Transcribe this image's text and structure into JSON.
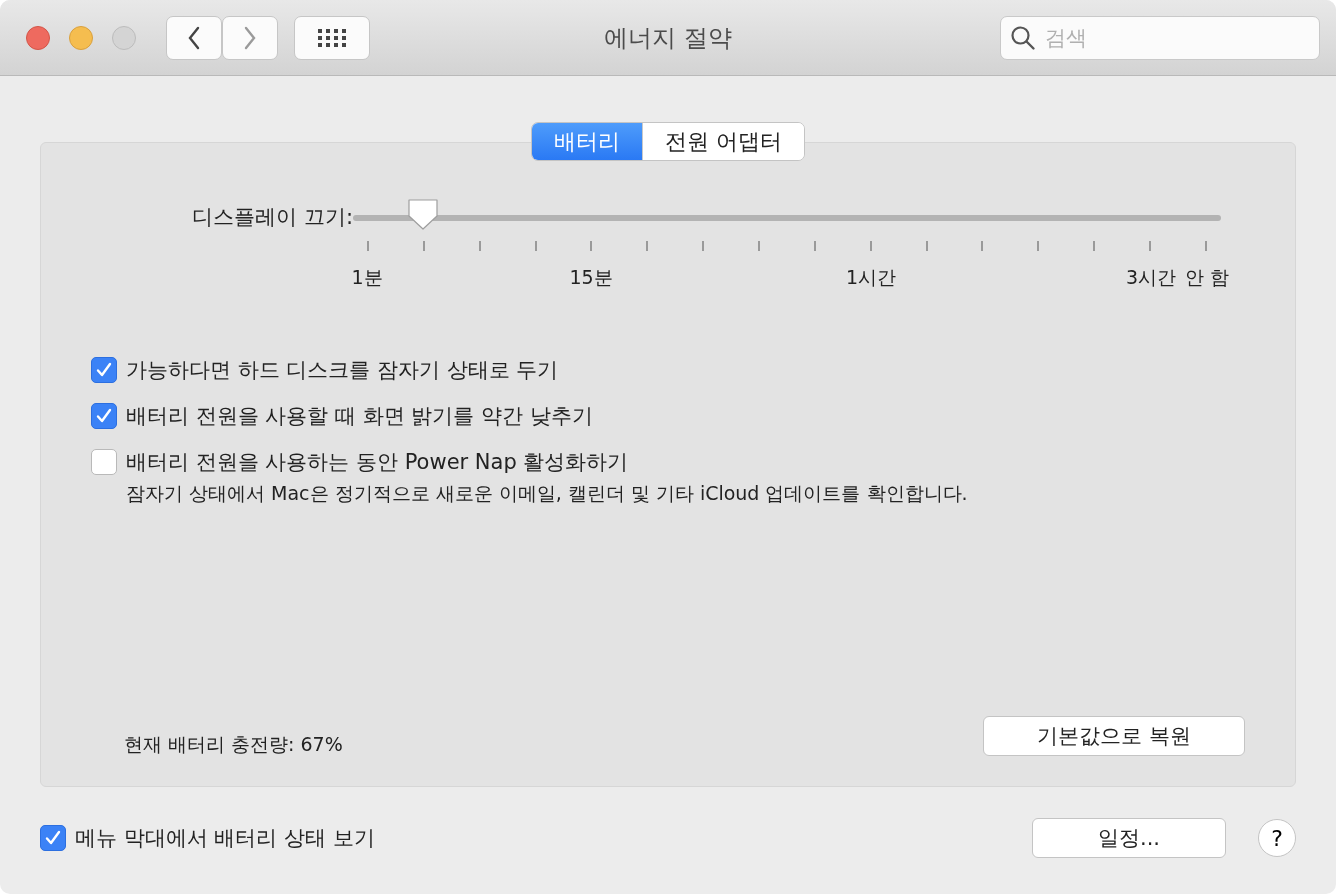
{
  "window": {
    "title": "에너지 절약",
    "search_placeholder": "검색"
  },
  "tabs": [
    {
      "label": "배터리",
      "selected": true
    },
    {
      "label": "전원 어댑터",
      "selected": false
    }
  ],
  "display_off": {
    "label": "디스플레이 끄기:",
    "level": 0.0667,
    "tick_labels": [
      "1분",
      "15분",
      "1시간",
      "3시간",
      "안 함"
    ]
  },
  "options": [
    {
      "label": "가능하다면 하드 디스크를 잠자기 상태로 두기",
      "checked": true
    },
    {
      "label": "배터리 전원을 사용할 때 화면 밝기를 약간 낮추기",
      "checked": true
    },
    {
      "label": "배터리 전원을 사용하는 동안 Power Nap 활성화하기",
      "checked": false,
      "description": "잠자기 상태에서 Mac은 정기적으로 새로운 이메일, 캘린더 및 기타 iCloud 업데이트를 확인합니다."
    }
  ],
  "battery_charge": "현재 배터리 충전량: 67%",
  "restore_button": "기본값으로 복원",
  "menu_bar_option": {
    "label": "메뉴 막대에서 배터리 상태 보기",
    "checked": true
  },
  "schedule_button": "일정...",
  "help_button": "?"
}
